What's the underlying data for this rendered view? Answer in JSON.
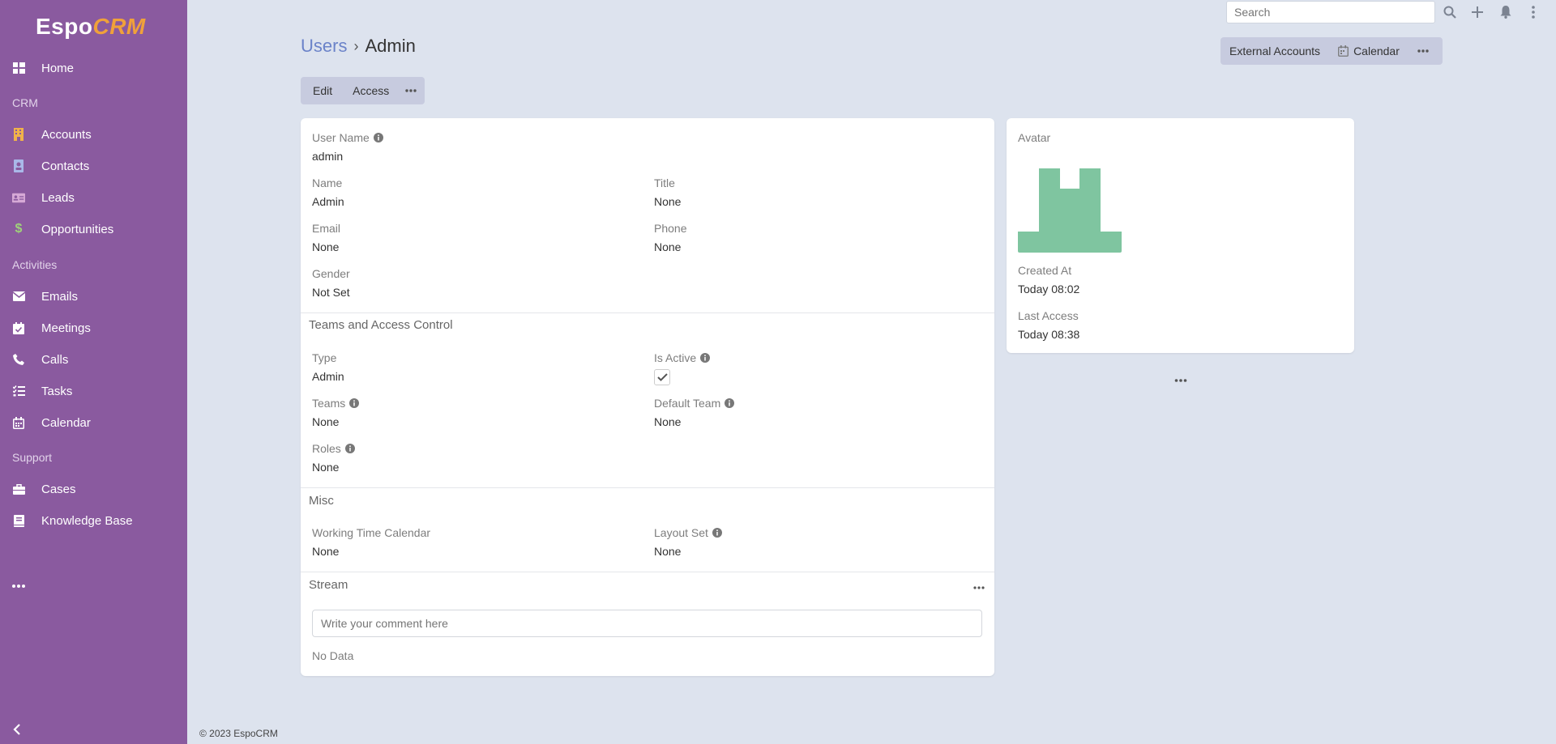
{
  "sidebar": {
    "logo": {
      "main": "Espo",
      "accent": "CRM"
    },
    "home": "Home",
    "group_crm": "CRM",
    "accounts": "Accounts",
    "contacts": "Contacts",
    "leads": "Leads",
    "opportunities": "Opportunities",
    "group_activities": "Activities",
    "emails": "Emails",
    "meetings": "Meetings",
    "calls": "Calls",
    "tasks": "Tasks",
    "calendar": "Calendar",
    "group_support": "Support",
    "cases": "Cases",
    "knowledge_base": "Knowledge Base"
  },
  "topbar": {
    "search_placeholder": "Search"
  },
  "header": {
    "breadcrumb_parent": "Users",
    "breadcrumb_sep": "›",
    "breadcrumb_current": "Admin",
    "external_accounts": "External Accounts",
    "calendar": "Calendar"
  },
  "actions": {
    "edit": "Edit",
    "access": "Access"
  },
  "detail": {
    "user_name_label": "User Name",
    "user_name_value": "admin",
    "name_label": "Name",
    "name_value": "Admin",
    "title_label": "Title",
    "title_value": "None",
    "email_label": "Email",
    "email_value": "None",
    "phone_label": "Phone",
    "phone_value": "None",
    "gender_label": "Gender",
    "gender_value": "Not Set",
    "teams_section": "Teams and Access Control",
    "type_label": "Type",
    "type_value": "Admin",
    "is_active_label": "Is Active",
    "is_active_value": true,
    "teams_label": "Teams",
    "teams_value": "None",
    "default_team_label": "Default Team",
    "default_team_value": "None",
    "roles_label": "Roles",
    "roles_value": "None",
    "misc_section": "Misc",
    "working_time_label": "Working Time Calendar",
    "working_time_value": "None",
    "layout_set_label": "Layout Set",
    "layout_set_value": "None",
    "stream_section": "Stream",
    "comment_placeholder": "Write your comment here",
    "no_data": "No Data"
  },
  "side": {
    "avatar_label": "Avatar",
    "created_at_label": "Created At",
    "created_at_value": "Today 08:02",
    "last_access_label": "Last Access",
    "last_access_value": "Today 08:38"
  },
  "footer": "© 2023 EspoCRM",
  "colors": {
    "sidebar": "#8a5a9f",
    "background": "#dde3ee",
    "link": "#6b83c9",
    "avatar": "#7fc5a0",
    "logo_accent": "#f0a13a"
  }
}
